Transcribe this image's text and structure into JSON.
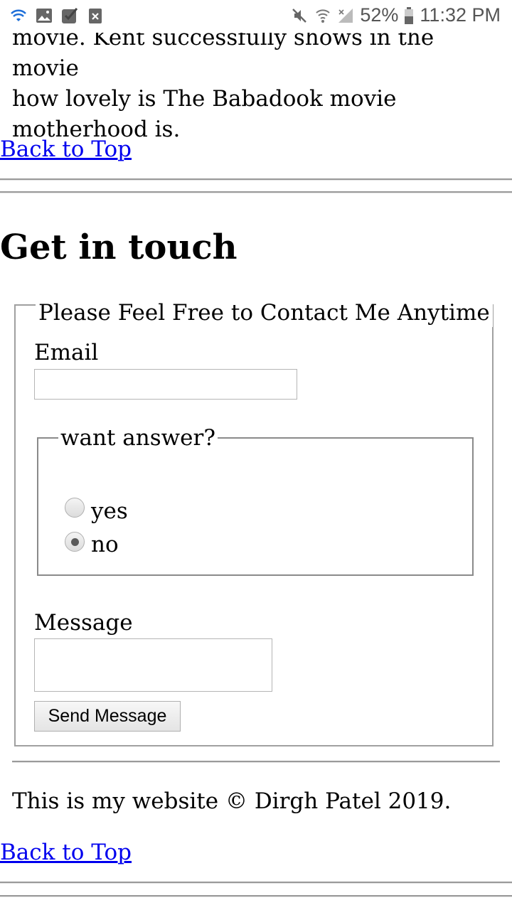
{
  "status_bar": {
    "left_icons": [
      "wifi-calling-icon",
      "image-icon",
      "checkbox-icon",
      "close-box-icon"
    ],
    "right_icons": [
      "mute-icon",
      "wifi-icon",
      "signal-icon",
      "battery-icon"
    ],
    "battery": "52%",
    "time": "11:32 PM"
  },
  "article": {
    "lines": [
      "movie. Kent successfully shows in the movie",
      "how lovely is The Babadook movie",
      "motherhood is."
    ]
  },
  "links": {
    "back_to_top": "Back to Top"
  },
  "contact": {
    "heading": "Get in touch",
    "form_legend": "Please Feel Free to Contact Me Anytime",
    "email_label": "Email",
    "email_value": "",
    "answer_legend": "want answer?",
    "options": [
      {
        "label": "yes",
        "checked": false
      },
      {
        "label": "no",
        "checked": true
      }
    ],
    "message_label": "Message",
    "message_value": "",
    "send_label": "Send Message"
  },
  "footer": {
    "text": "This is my website © Dirgh Patel 2019."
  }
}
